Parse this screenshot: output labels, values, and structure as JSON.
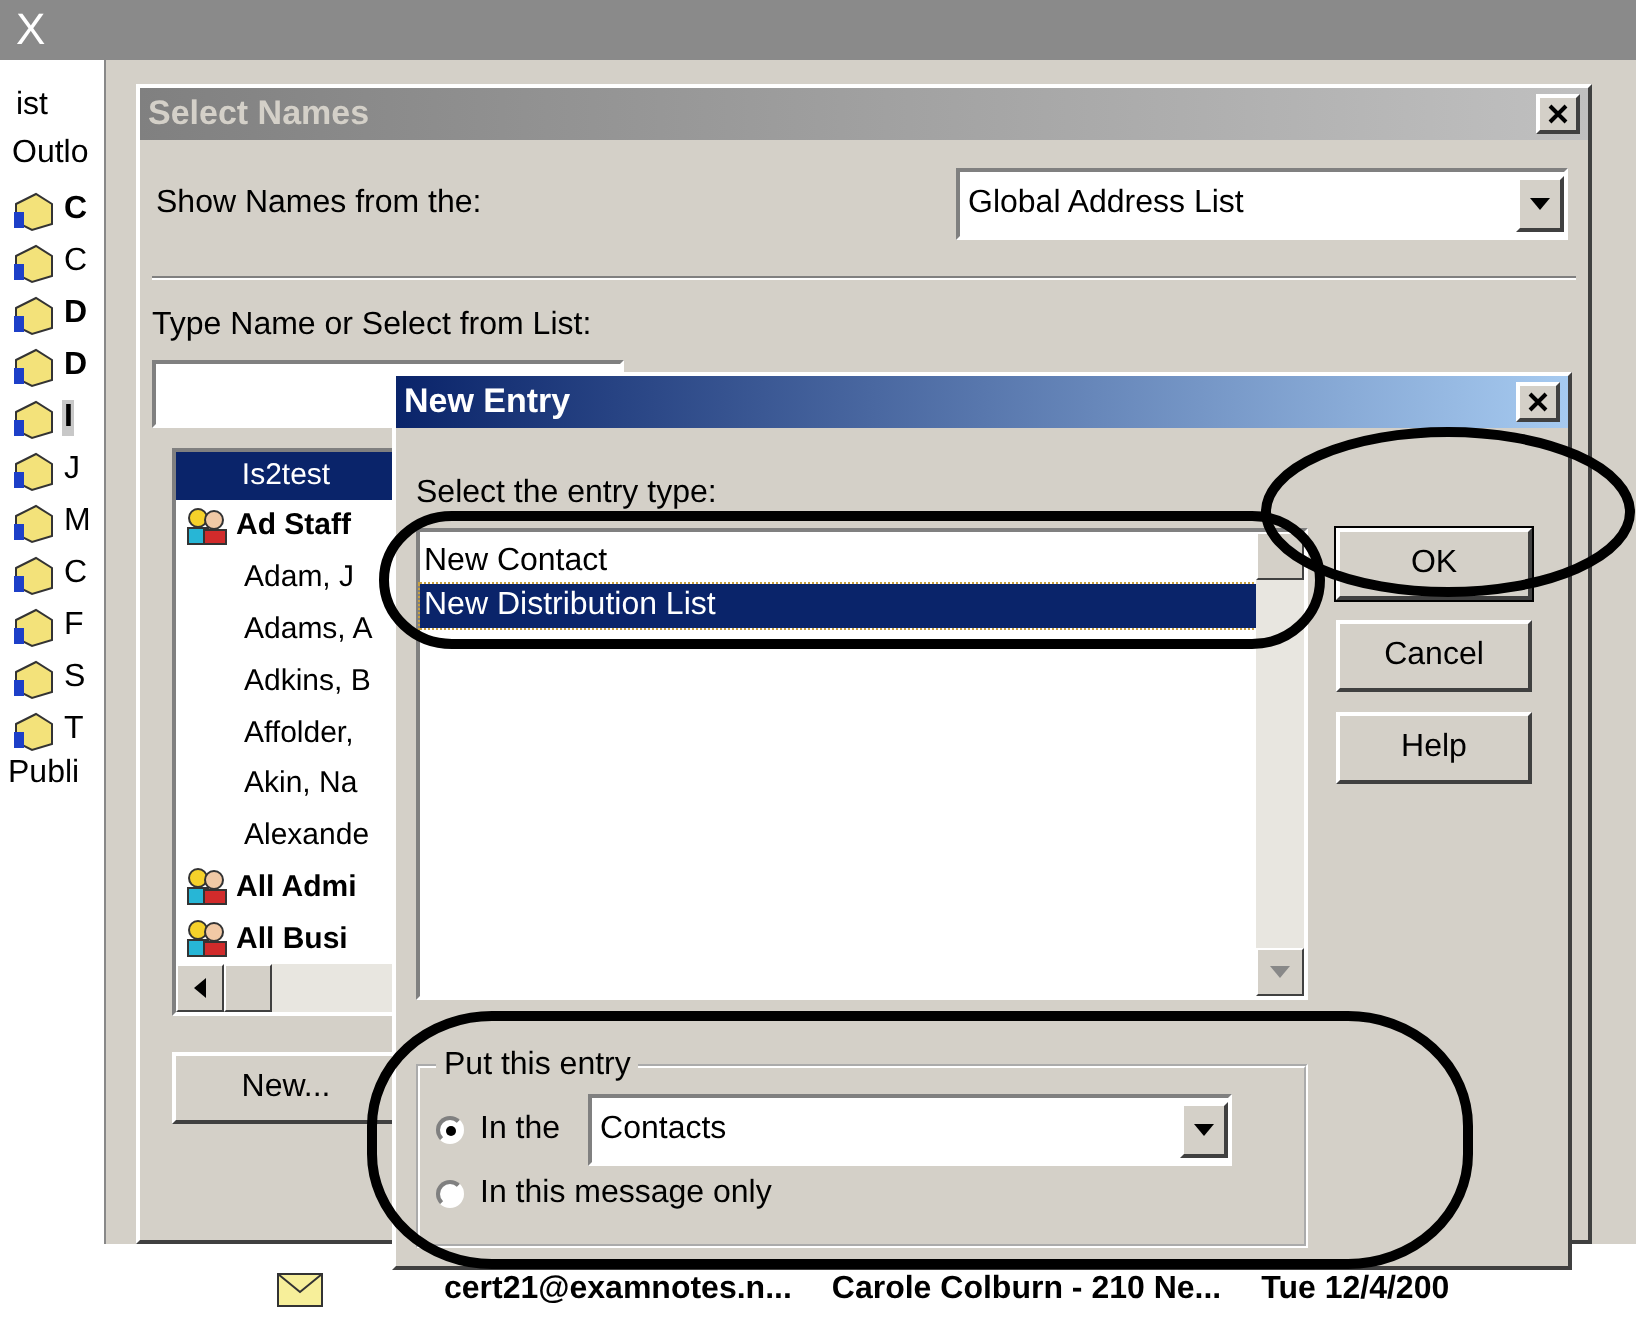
{
  "app": {
    "close_glyph": "X",
    "folder_pane": {
      "header": "ist",
      "root": "Outlo",
      "folders": [
        {
          "label": "C",
          "bold": true,
          "selected": false
        },
        {
          "label": "C",
          "bold": false,
          "selected": false
        },
        {
          "label": "D",
          "bold": true,
          "selected": false
        },
        {
          "label": "D",
          "bold": true,
          "selected": false
        },
        {
          "label": "I",
          "bold": true,
          "selected": true
        },
        {
          "label": "J",
          "bold": false,
          "selected": false
        },
        {
          "label": "M",
          "bold": false,
          "selected": false
        },
        {
          "label": "C",
          "bold": false,
          "selected": false
        },
        {
          "label": "F",
          "bold": false,
          "selected": false
        },
        {
          "label": "S",
          "bold": false,
          "selected": false
        },
        {
          "label": "T",
          "bold": false,
          "selected": false
        }
      ],
      "footer": "Publi"
    },
    "message_row": {
      "from": "cert21@examnotes.n...",
      "subject": "Carole Colburn - 210 Ne...",
      "received": "Tue 12/4/200"
    }
  },
  "select_names": {
    "title": "Select Names",
    "active": false,
    "show_label": "Show Names from the:",
    "address_book": "Global Address List",
    "type_label": "Type Name or Select from List:",
    "list_header": "Is2test",
    "entries": [
      {
        "name": "Ad Staff",
        "kind": "group"
      },
      {
        "name": "Adam, J",
        "kind": "person"
      },
      {
        "name": "Adams, A",
        "kind": "person"
      },
      {
        "name": "Adkins, B",
        "kind": "person"
      },
      {
        "name": "Affolder,",
        "kind": "person"
      },
      {
        "name": "Akin, Na",
        "kind": "person"
      },
      {
        "name": "Alexande",
        "kind": "person"
      },
      {
        "name": "All Admi",
        "kind": "group"
      },
      {
        "name": "All Busi",
        "kind": "group"
      }
    ],
    "new_button": "New..."
  },
  "new_entry": {
    "title": "New Entry",
    "active": true,
    "prompt": "Select the entry type:",
    "types": [
      {
        "label": "New Contact",
        "selected": false
      },
      {
        "label": "New Distribution List",
        "selected": true
      }
    ],
    "buttons": [
      "OK",
      "Cancel",
      "Help"
    ],
    "put_group": {
      "legend": "Put this entry",
      "folder": "Contacts",
      "options": [
        {
          "label": "In the",
          "selected": true
        },
        {
          "label": "In this message only",
          "selected": false
        }
      ]
    }
  }
}
